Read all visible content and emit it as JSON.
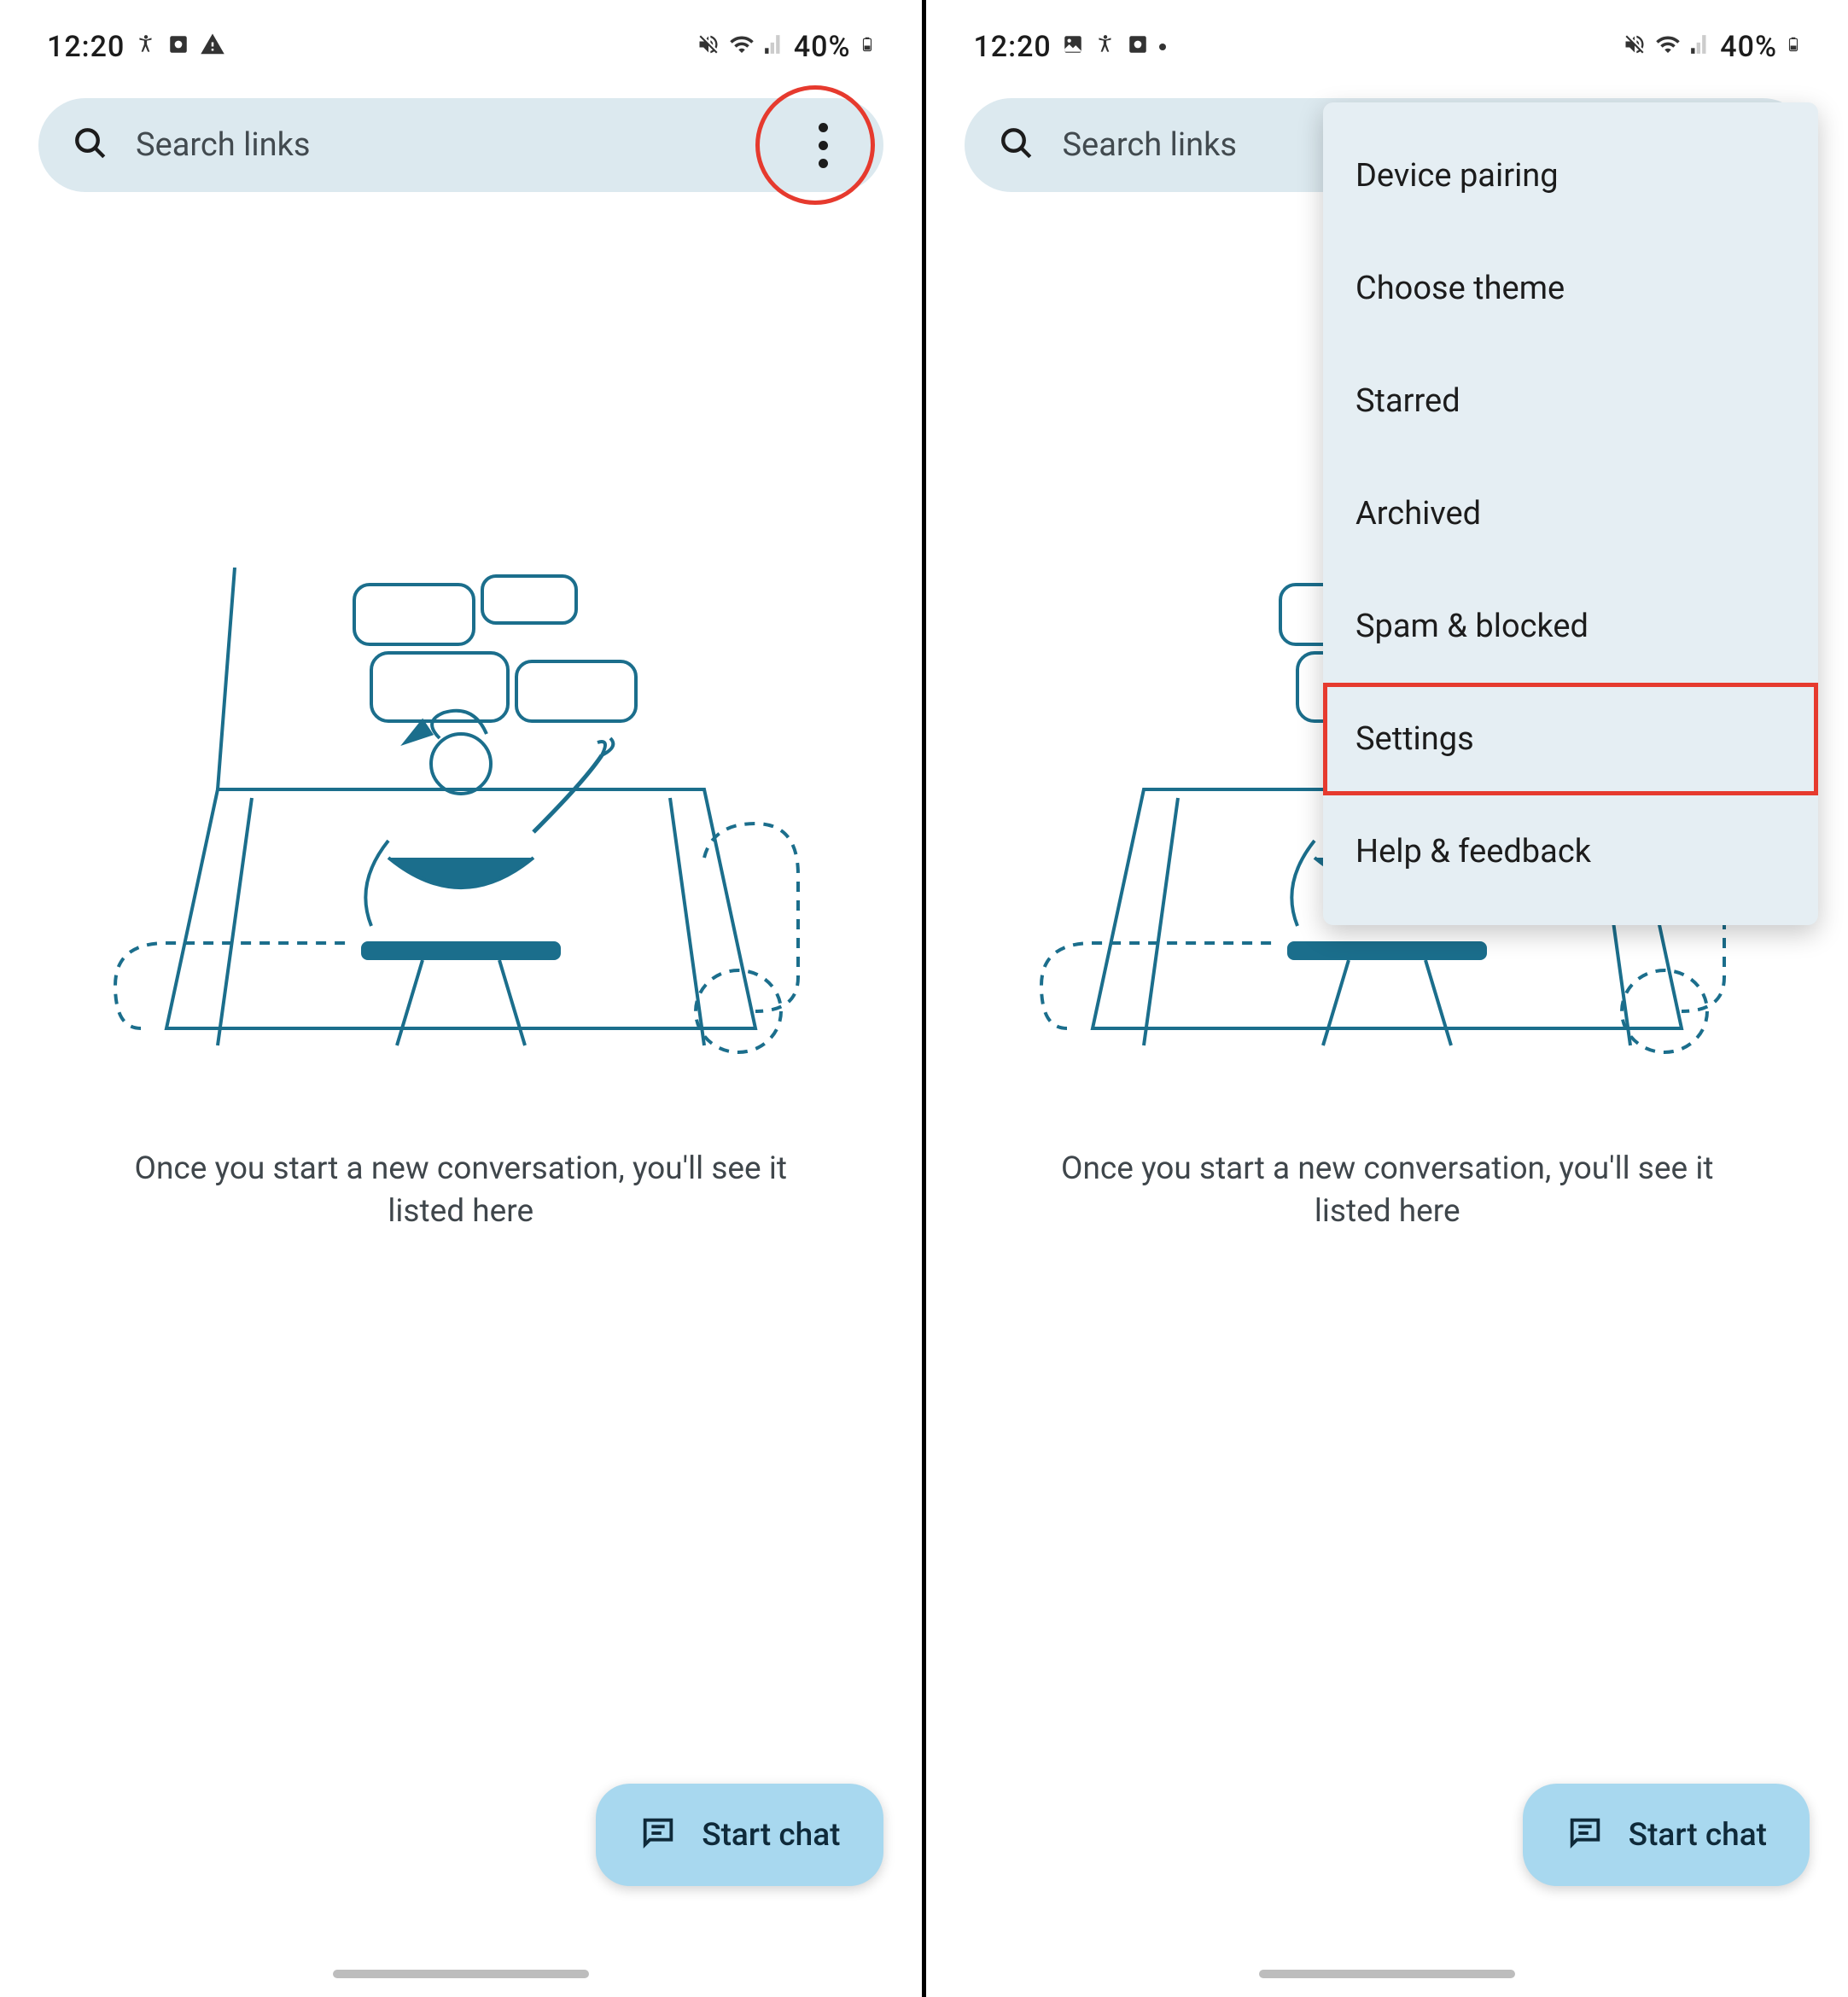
{
  "statusBar": {
    "time": "12:20",
    "battery": "40%"
  },
  "search": {
    "placeholder": "Search links"
  },
  "emptyState": {
    "text": "Once you start a new conversation, you'll see it listed here"
  },
  "startChat": {
    "label": "Start chat"
  },
  "menu": {
    "items": [
      "Device pairing",
      "Choose theme",
      "Starred",
      "Archived",
      "Spam & blocked",
      "Settings",
      "Help & feedback"
    ],
    "highlightedIndex": 5
  }
}
